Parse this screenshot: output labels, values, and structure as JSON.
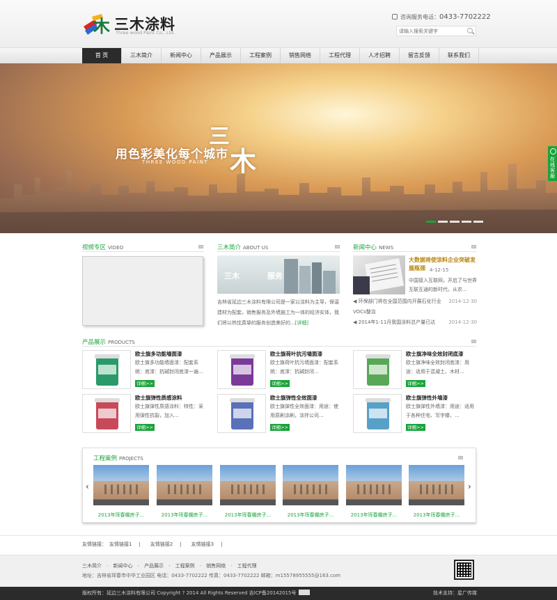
{
  "header": {
    "logo_cn": "三木涂料",
    "logo_en": "Three wood Paint Co., Ltd.",
    "hotline_label": "咨询服务电话：",
    "hotline_number": "0433-7702222",
    "search_placeholder": "请输入搜索关键字"
  },
  "nav": [
    "首 页",
    "三木简介",
    "新闻中心",
    "产品展示",
    "工程案例",
    "销售网络",
    "工程代理",
    "人才招聘",
    "留言反馈",
    "联系我们"
  ],
  "banner": {
    "slogan": "用色彩美化每个城市",
    "slogan_en": "THREE WOOD PAINT",
    "big1": "三",
    "big2": "木",
    "side_service": "在线客服"
  },
  "video": {
    "title": "视频专区",
    "title_en": "VIDEO"
  },
  "about": {
    "title": "三木简介",
    "title_en": "ABOUT US",
    "img_text1": "三木",
    "img_text2": "服务",
    "text": "吉林省延边三木涂料有限公司是一家以涂料为主导，保温建材为配套，销售服务及外墙施工为一体的经济实体，我们将以热忱真挚的服务创造美好的...",
    "more": "[详细]"
  },
  "news": {
    "title": "新闻中心",
    "title_en": "NEWS",
    "headline": "大数据将使涂料企业突破发展瓶颈",
    "headline_date": "4-12-15",
    "summary": "中国接入互联网，开启了与世界互联互通的新时代，从农...",
    "items": [
      {
        "text": "环保部门将在全国范围内开展石化行业VOCs整治",
        "date": "2014-12-30"
      },
      {
        "text": "2014年1-11月我国涂料总产量已达",
        "date": "2014-12-30"
      }
    ]
  },
  "products": {
    "title": "产品展示",
    "title_en": "PRODUCTS",
    "detail_label": "详细>>",
    "items": [
      {
        "name": "欧士旗多功能墙面漆",
        "desc": "欧士旗多功能墙面漆：配套系统：底漆：抗碱封闭底漆一遍...",
        "color": "#2a9a6a"
      },
      {
        "name": "欧士旗荷叶抗污墙面漆",
        "desc": "欧士旗荷叶抗污墙面漆：配套系统：底漆：抗碱封闭...",
        "color": "#7a3a9a"
      },
      {
        "name": "欧士旗净味全效封闭底漆",
        "desc": "欧士旗净味全效封闭底漆：用途：适用于混凝土、木材...",
        "color": "#58a858"
      },
      {
        "name": "欧士旗弹性质感涂料",
        "desc": "欧士旗弹性质感涂料：特性：采用弹性抗裂，加入...",
        "color": "#c84a5a"
      },
      {
        "name": "欧士旗弹性全效面漆",
        "desc": "欧士旗弹性全效面漆：用途：使用原刷涂刷，涂拌公司...",
        "color": "#5a70b8"
      },
      {
        "name": "欧士旗弹性外墙漆",
        "desc": "欧士旗弹性外墙漆：用途：适用于各种住宅、写字楼、...",
        "color": "#58a0c8"
      }
    ]
  },
  "projects": {
    "title": "工程案例",
    "title_en": "PROJECTS",
    "items": [
      "2013年珲春棚房子...",
      "2013年珲春棚房子...",
      "2013年珲春棚房子...",
      "2013年珲春棚房子...",
      "2013年珲春棚房子...",
      "2013年珲春棚房子..."
    ]
  },
  "friend_links": [
    "友情链接：",
    "友情链接1",
    "|",
    "友情链接2",
    "|",
    "友情链接3",
    "|"
  ],
  "footer": {
    "links": [
      "三木简介",
      "新闻中心",
      "产品展示",
      "工程案例",
      "销售网络",
      "工程代理"
    ],
    "address": "地址：吉林省珲春市中华工业园区   电话：0433-7702222   传真：0433-7702222   邮箱：m15578955555@163.com",
    "copyright": "版权所有：延边三木涂料有限公司 Copyright ? 2014 All Rights Reserved   吉ICP备20142015号",
    "support": "技术支持：星广传媒"
  }
}
